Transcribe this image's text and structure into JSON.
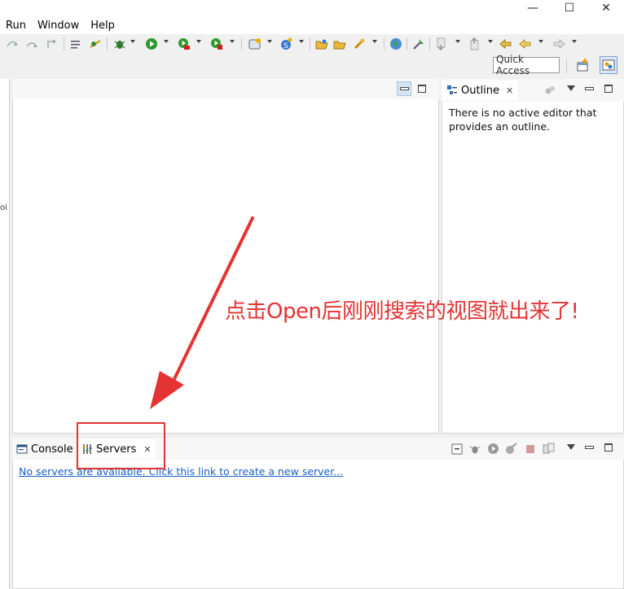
{
  "window": {
    "controls": {
      "minimize": "—",
      "maximize": "☐",
      "close": "✕"
    }
  },
  "menubar": {
    "items": [
      {
        "label": "Run",
        "mnemonic": "R"
      },
      {
        "label": "Window",
        "mnemonic": "W"
      },
      {
        "label": "Help",
        "mnemonic": "H"
      }
    ]
  },
  "toolbar": {
    "quick_access_placeholder": "Quick Access",
    "icons": [
      "step-into-icon",
      "step-over-icon",
      "step-return-icon",
      "use-step-filters-icon",
      "skip-breakpoints-icon",
      "debug-icon",
      "run-icon",
      "run-coverage-icon",
      "external-tools-icon",
      "new-java-project-icon",
      "new-java-class-icon",
      "open-type-icon",
      "open-task-icon",
      "search-icon",
      "web-browser-icon",
      "run-last-tool-icon",
      "next-annotation-icon",
      "previous-annotation-icon",
      "last-edit-location-icon",
      "back-icon",
      "forward-icon"
    ],
    "perspectives": [
      "open-perspective-icon",
      "java-ee-perspective-icon"
    ]
  },
  "outline": {
    "tab_label": "Outline",
    "message": "There is no active editor that provides an outline."
  },
  "bottom_panel": {
    "tabs": [
      {
        "label": "Console",
        "active": false
      },
      {
        "label": "Servers",
        "active": true
      }
    ],
    "servers_link": "No servers are available. Click this link to create a new server..."
  },
  "annotation": {
    "text": "点击Open后刚刚搜索的视图就出来了!",
    "color": "#e53333"
  },
  "left_strip": {
    "clipped_text": "oi"
  }
}
